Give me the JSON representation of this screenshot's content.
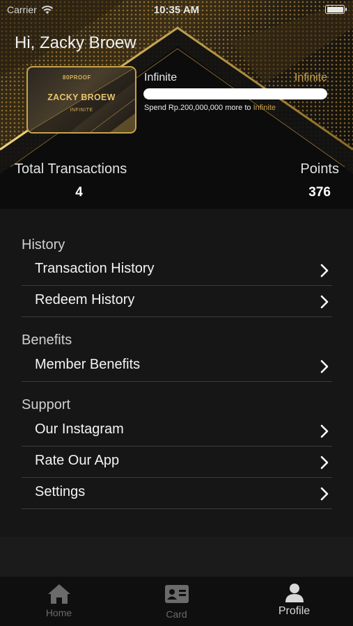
{
  "status_bar": {
    "carrier": "Carrier",
    "time": "10:35 AM"
  },
  "greeting": "Hi, Zacky Broew",
  "card": {
    "brand": "80PROOF",
    "holder_name": "ZACKY BROEW",
    "tier": "INFINITE"
  },
  "tier_progress": {
    "current_tier": "Infinite",
    "next_tier": "Infinite",
    "progress_fraction": 1.0,
    "spend_prefix": "Spend Rp.200,000,000 more to",
    "spend_target": "Infinite"
  },
  "stats": {
    "transactions_label": "Total Transactions",
    "transactions_value": "4",
    "points_label": "Points",
    "points_value": "376"
  },
  "sections": {
    "history": {
      "title": "History",
      "items": [
        "Transaction History",
        "Redeem History"
      ]
    },
    "benefits": {
      "title": "Benefits",
      "items": [
        "Member Benefits"
      ]
    },
    "support": {
      "title": "Support",
      "items": [
        "Our Instagram",
        "Rate Our App",
        "Settings"
      ]
    }
  },
  "tabs": [
    {
      "label": "Home",
      "icon": "home-icon",
      "active": false
    },
    {
      "label": "Card",
      "icon": "id-card-icon",
      "active": false
    },
    {
      "label": "Profile",
      "icon": "person-icon",
      "active": true
    }
  ],
  "colors": {
    "accent_gold": "#c9a24a",
    "background": "#151515",
    "divider": "#3c3c3c"
  }
}
